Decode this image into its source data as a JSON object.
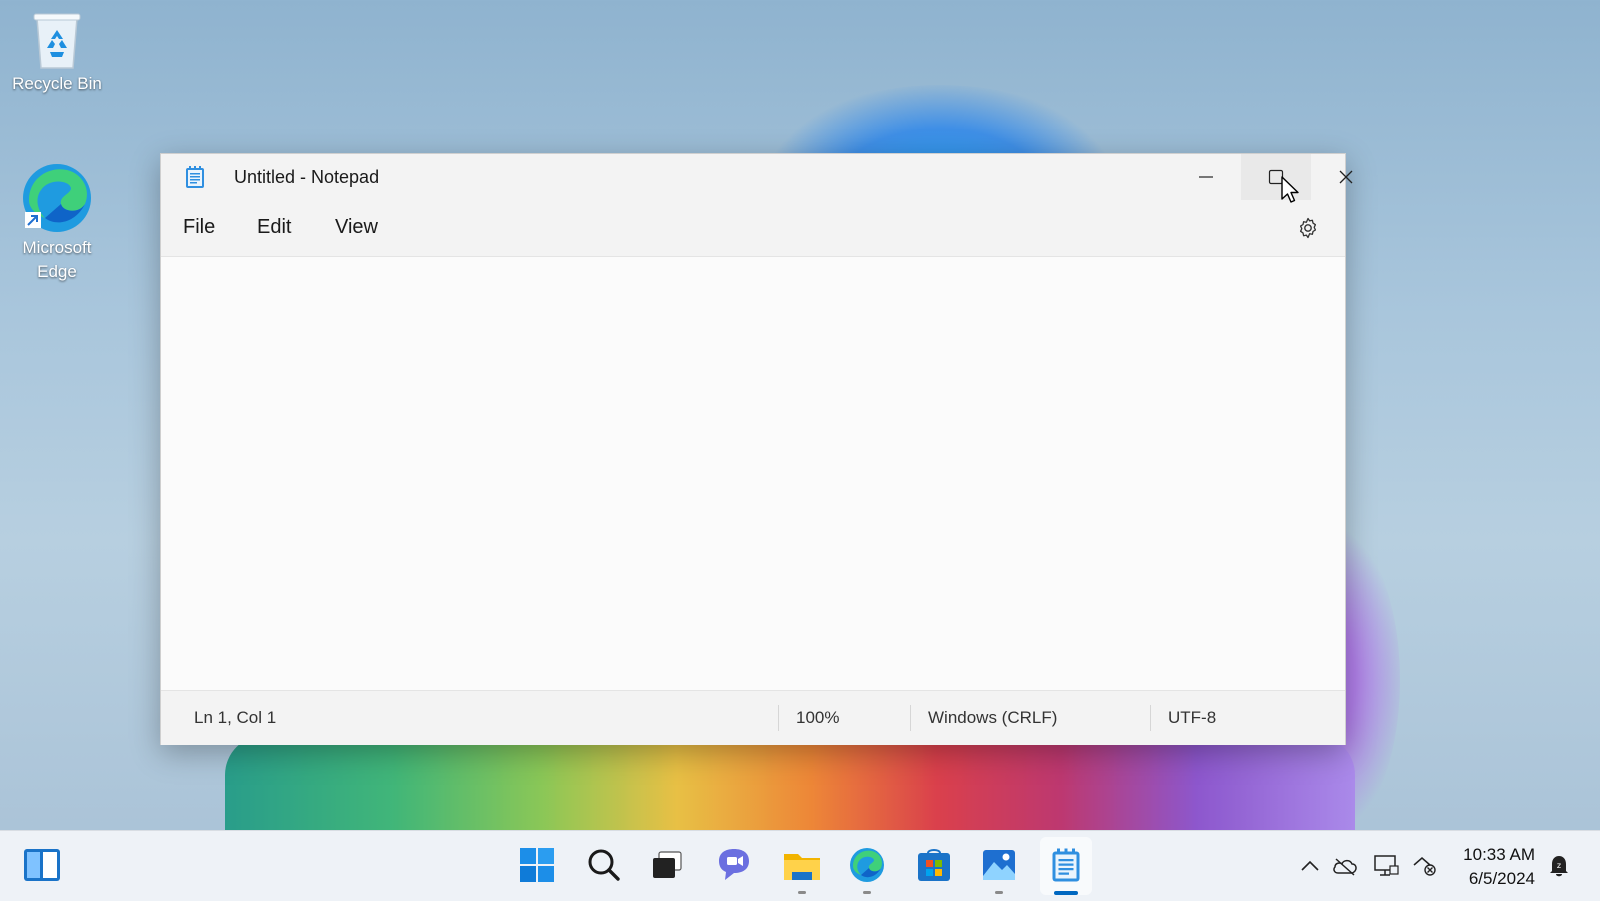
{
  "desktop": {
    "icons": [
      {
        "label": "Recycle Bin",
        "icon": "recycle-bin-icon"
      },
      {
        "label": "Microsoft Edge",
        "icon": "edge-icon"
      }
    ]
  },
  "window": {
    "title": "Untitled - Notepad",
    "app_icon": "notepad-icon",
    "controls": {
      "minimize": "minimize-icon",
      "maximize": "maximize-icon",
      "close": "close-icon"
    },
    "menu": {
      "file": "File",
      "edit": "Edit",
      "view": "View"
    },
    "settings_icon": "gear-icon",
    "editor_text": "",
    "status": {
      "position": "Ln 1, Col 1",
      "zoom": "100%",
      "line_ending": "Windows (CRLF)",
      "encoding": "UTF-8"
    }
  },
  "taskbar": {
    "widgets": "widgets-icon",
    "apps": [
      "start-icon",
      "search-icon",
      "task-view-icon",
      "chat-icon",
      "file-explorer-icon",
      "edge-icon",
      "store-icon",
      "photos-icon",
      "notepad-icon"
    ],
    "active_app": "notepad-icon",
    "tray": [
      "chevron-up-icon",
      "onedrive-icon",
      "display-icon",
      "network-icon"
    ],
    "clock": {
      "time": "10:33 AM",
      "date": "6/5/2024"
    },
    "notification_icon": "notification-icon"
  },
  "colors": {
    "accent": "#0067c0",
    "taskbar": "#eef2f7",
    "window": "#fbfbfb"
  }
}
